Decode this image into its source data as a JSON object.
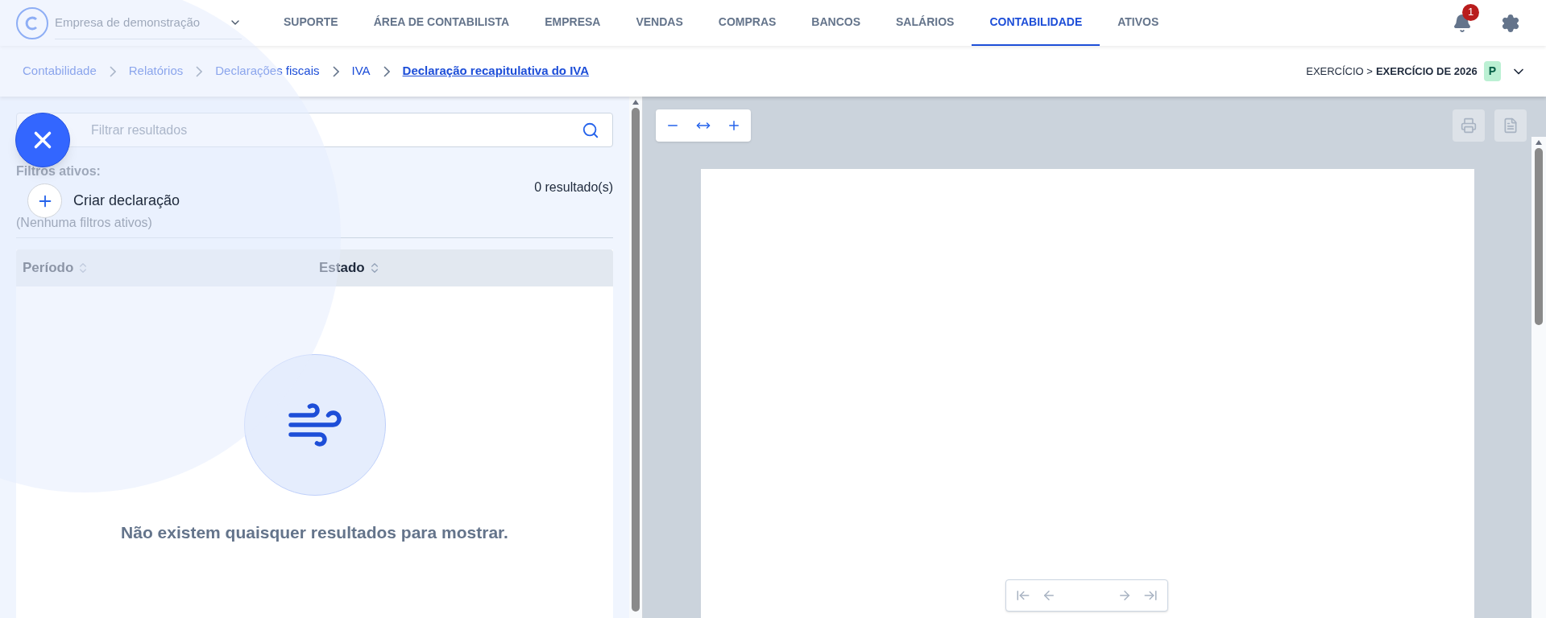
{
  "header": {
    "company": "Empresa de demonstração",
    "notifications": "1",
    "nav": [
      {
        "label": "SUPORTE",
        "selected": false
      },
      {
        "label": "ÁREA DE CONTABILISTA",
        "selected": false
      },
      {
        "label": "EMPRESA",
        "selected": false
      },
      {
        "label": "VENDAS",
        "selected": false
      },
      {
        "label": "COMPRAS",
        "selected": false
      },
      {
        "label": "BANCOS",
        "selected": false
      },
      {
        "label": "SALÁRIOS",
        "selected": false
      },
      {
        "label": "CONTABILIDADE",
        "selected": true
      },
      {
        "label": "ATIVOS",
        "selected": false
      }
    ]
  },
  "breadcrumb": [
    {
      "label": "Contabilidade",
      "current": false
    },
    {
      "label": "Relatórios",
      "current": false
    },
    {
      "label": "Declarações fiscais",
      "current": false
    },
    {
      "label": "IVA",
      "current": false
    },
    {
      "label": "Declaração recapitulativa do IVA",
      "current": true
    }
  ],
  "fiscal_year": {
    "label": "EXERCÍCIO >",
    "value": "EXERCÍCIO DE 2026",
    "badge": "P"
  },
  "filters": {
    "placeholder": "Filtrar resultados",
    "active_label": "Filtros ativos:",
    "active_value": "(Nenhuma filtros ativos)",
    "result_count": "0 resultado(s)"
  },
  "table": {
    "columns": [
      "Período",
      "Estado"
    ],
    "empty_message": "Não existem quaisquer resultados para mostrar."
  },
  "viewer": {
    "buttons": [
      {
        "kind": "print",
        "disabled": true
      },
      {
        "kind": "document",
        "disabled": true
      }
    ],
    "pager_disabled": true
  },
  "speed_dial": {
    "open": true,
    "actions": [
      {
        "label": "Criar declaração"
      }
    ]
  }
}
